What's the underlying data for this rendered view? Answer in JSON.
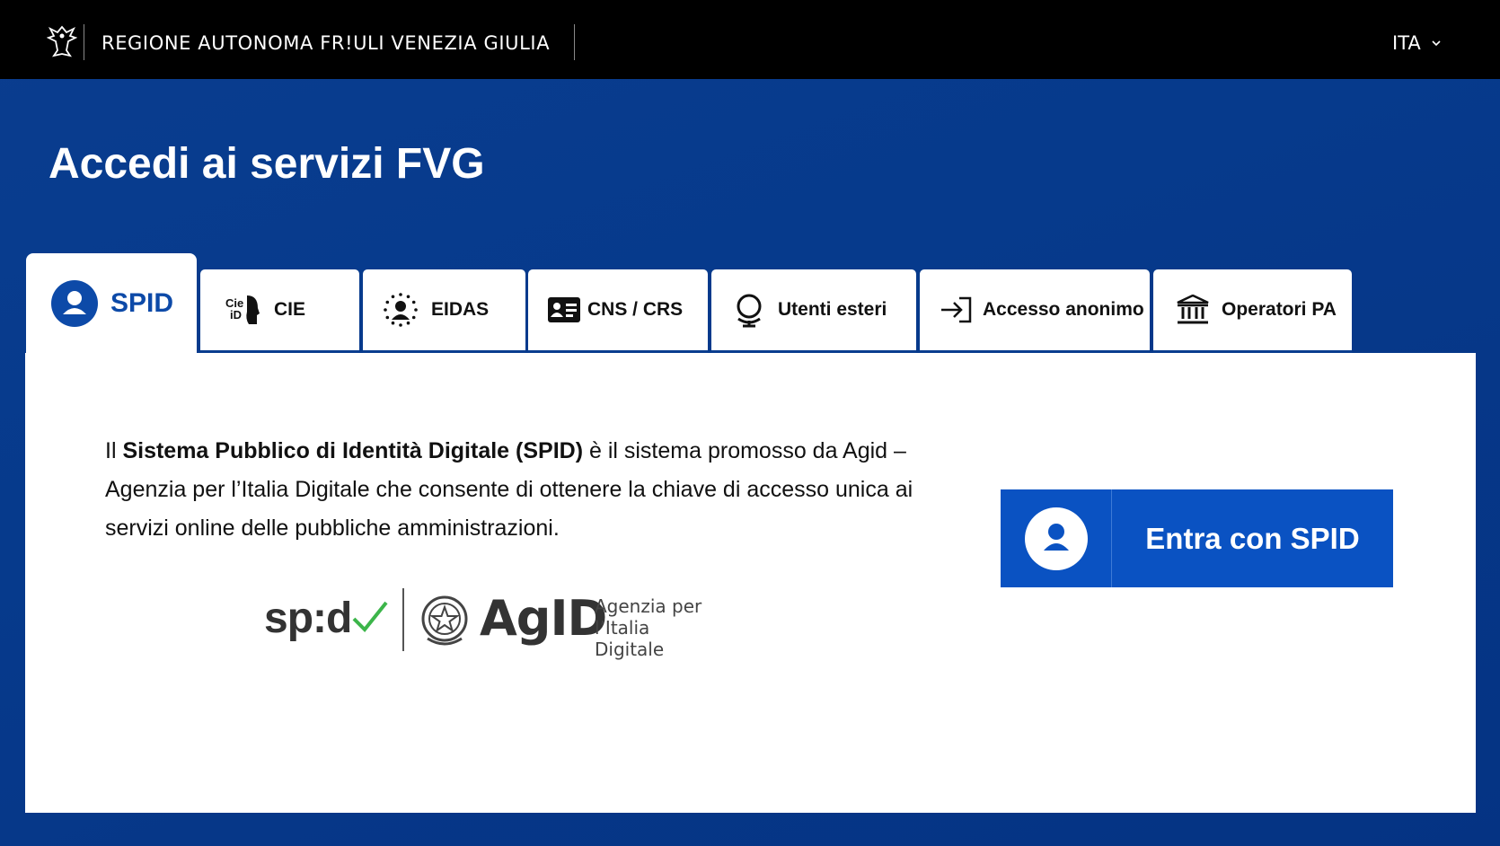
{
  "header": {
    "region_name": "REGIONE AUTONOMA FR!ULI VENEZIA GIULIA",
    "language": "ITA",
    "logo_icon": "eagle-icon",
    "background": "#000000"
  },
  "page": {
    "title": "Accedi ai servizi FVG",
    "background": "#0a3d8f"
  },
  "tabs": [
    {
      "label": "SPID",
      "icon": "person-circle-icon",
      "active": true
    },
    {
      "label": "CIE",
      "icon": "cie-id-icon",
      "icon_text_top": "Cie",
      "icon_text_bottom": "iD",
      "active": false
    },
    {
      "label": "EIDAS",
      "icon": "eidas-stars-icon",
      "active": false
    },
    {
      "label": "CNS / CRS",
      "icon": "id-card-icon",
      "active": false
    },
    {
      "label": "Utenti esteri",
      "icon": "globe-icon",
      "active": false
    },
    {
      "label": "Accesso anonimo",
      "icon": "login-arrow-icon",
      "active": false
    },
    {
      "label": "Operatori PA",
      "icon": "institution-icon",
      "active": false
    }
  ],
  "spid_panel": {
    "desc_prefix": "Il ",
    "desc_bold": "Sistema Pubblico di Identità Digitale (SPID)",
    "desc_suffix": " è il sistema promosso da Agid – Agenzia per l’Italia Digitale che consente di ottenere la chiave di accesso unica ai servizi online delle pubbliche amministrazioni.",
    "spid_logo_text": "sp:d",
    "agid_word": "AgID",
    "agid_sub": "Agenzia per l’Italia Digitale",
    "cta_label": "Entra con SPID",
    "cta_color": "#0a52c2"
  }
}
